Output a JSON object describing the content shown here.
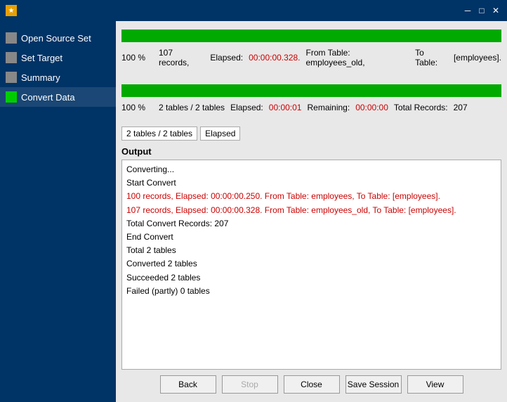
{
  "titleBar": {
    "icon": "★",
    "title": "",
    "minBtn": "─",
    "maxBtn": "□",
    "closeBtn": "✕"
  },
  "sidebar": {
    "items": [
      {
        "id": "open-source-set",
        "label": "Open Source Set",
        "iconType": "gray"
      },
      {
        "id": "set-target",
        "label": "Set Target",
        "iconType": "gray"
      },
      {
        "id": "summary",
        "label": "Summary",
        "iconType": "gray"
      },
      {
        "id": "convert-data",
        "label": "Convert Data",
        "iconType": "green",
        "active": true
      }
    ]
  },
  "progress1": {
    "percent": "100 %",
    "records": "107 records,",
    "elapsed_label": "Elapsed:",
    "elapsed_value": "00:00:00.328.",
    "from_label": "From Table: employees_old,",
    "to_label": "To Table:",
    "to_value": "[employees]."
  },
  "progress2": {
    "percent": "100 %",
    "tables": "2 tables / 2 tables",
    "elapsed_label": "Elapsed:",
    "elapsed_value": "00:00:01",
    "remaining_label": "Remaining:",
    "remaining_value": "00:00:00",
    "total_label": "Total Records:",
    "total_value": "207"
  },
  "scrollRow": {
    "cell1": "2 tables / 2 tables",
    "cell2": "Elapsed"
  },
  "output": {
    "label": "Output",
    "lines": [
      {
        "text": "Converting...",
        "type": "normal"
      },
      {
        "text": "Start Convert",
        "type": "normal"
      },
      {
        "text": "100 records,   Elapsed: 00:00:00.250.    From Table: employees,    To Table: [employees].",
        "type": "red"
      },
      {
        "text": "107 records,   Elapsed: 00:00:00.328.    From Table: employees_old,    To Table: [employees].",
        "type": "red"
      },
      {
        "text": "Total Convert Records: 207",
        "type": "normal"
      },
      {
        "text": "End Convert",
        "type": "normal"
      },
      {
        "text": "Total 2 tables",
        "type": "normal"
      },
      {
        "text": "Converted 2 tables",
        "type": "normal"
      },
      {
        "text": "Succeeded 2 tables",
        "type": "normal"
      },
      {
        "text": "Failed (partly) 0 tables",
        "type": "normal"
      }
    ]
  },
  "footer": {
    "back": "Back",
    "stop": "Stop",
    "close": "Close",
    "saveSession": "Save Session",
    "view": "View"
  }
}
